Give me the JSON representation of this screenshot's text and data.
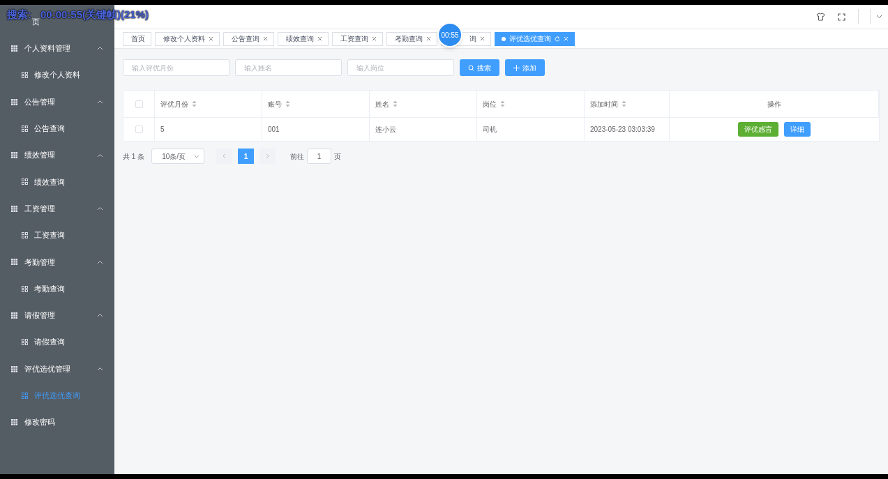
{
  "recorder_overlay": {
    "label": "搜索:",
    "text": "00:00:55(关键帧)(21%)",
    "timer": "00:55"
  },
  "sidebar": {
    "items": [
      {
        "label": "页",
        "kind": "link",
        "selected": false
      },
      {
        "label": "个人资料管理",
        "kind": "group",
        "expanded": true,
        "children": [
          {
            "label": "修改个人资料",
            "selected": false
          }
        ]
      },
      {
        "label": "公告管理",
        "kind": "group",
        "expanded": true,
        "children": [
          {
            "label": "公告查询",
            "selected": false
          }
        ]
      },
      {
        "label": "绩效管理",
        "kind": "group",
        "expanded": true,
        "children": [
          {
            "label": "绩效查询",
            "selected": false
          }
        ]
      },
      {
        "label": "工资管理",
        "kind": "group",
        "expanded": true,
        "children": [
          {
            "label": "工资查询",
            "selected": false
          }
        ]
      },
      {
        "label": "考勤管理",
        "kind": "group",
        "expanded": true,
        "children": [
          {
            "label": "考勤查询",
            "selected": false
          }
        ]
      },
      {
        "label": "请假管理",
        "kind": "group",
        "expanded": true,
        "children": [
          {
            "label": "请假查询",
            "selected": false
          }
        ]
      },
      {
        "label": "评优选优管理",
        "kind": "group",
        "expanded": true,
        "children": [
          {
            "label": "评优选优查询",
            "selected": true
          }
        ]
      },
      {
        "label": "修改密码",
        "kind": "link",
        "selected": false
      }
    ]
  },
  "tabs": [
    {
      "label": "首页",
      "closable": false,
      "selected": false
    },
    {
      "label": "修改个人资料",
      "closable": true,
      "selected": false
    },
    {
      "label": "公告查询",
      "closable": true,
      "selected": false
    },
    {
      "label": "绩效查询",
      "closable": true,
      "selected": false
    },
    {
      "label": "工资查询",
      "closable": true,
      "selected": false
    },
    {
      "label": "考勤查询",
      "closable": true,
      "selected": false
    },
    {
      "label": "询",
      "closable": true,
      "selected": false
    },
    {
      "label": "评优选优查询",
      "closable": true,
      "selected": true
    }
  ],
  "filters": [
    {
      "placeholder": "输入评优月份"
    },
    {
      "placeholder": "输入姓名"
    },
    {
      "placeholder": "输入岗位"
    }
  ],
  "buttons": [
    {
      "label": "搜索",
      "kind": "search"
    },
    {
      "label": "添加",
      "kind": "add"
    }
  ],
  "table": {
    "columns": [
      {
        "label": "评优月份",
        "sortable": true
      },
      {
        "label": "账号",
        "sortable": true
      },
      {
        "label": "姓名",
        "sortable": true
      },
      {
        "label": "岗位",
        "sortable": true
      },
      {
        "label": "添加时间",
        "sortable": true
      },
      {
        "label": "操作",
        "sortable": false
      }
    ],
    "rows": [
      {
        "checked": false,
        "cells": [
          "5",
          "001",
          "连小云",
          "司机",
          "2023-05-23 03:03:39"
        ],
        "actions": [
          {
            "label": "评优感言",
            "kind": "success"
          },
          {
            "label": "详细",
            "kind": "primary"
          }
        ]
      }
    ],
    "header_checked": false
  },
  "pagination": {
    "total": "共 1 条",
    "page_size": "10条/页",
    "pages": [
      {
        "label": "1",
        "selected": true
      }
    ],
    "goto_label": "前往",
    "goto_value": "1",
    "goto_suffix": "页"
  }
}
